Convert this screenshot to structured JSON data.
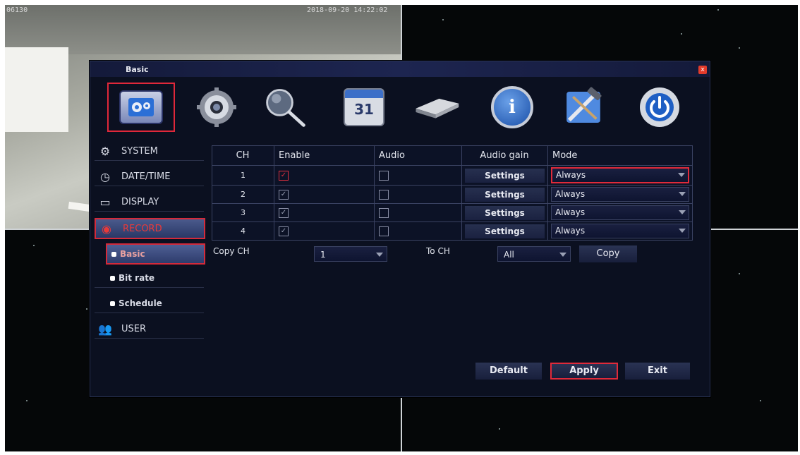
{
  "camera": {
    "channel_label": "06130",
    "timestamp": "2018-09-20 14:22:02"
  },
  "dialog": {
    "title": "Basic",
    "close_label": "x",
    "toolbar_icons": [
      "config-icon",
      "gear-icon",
      "search-icon",
      "calendar-icon",
      "hdd-icon",
      "info-icon",
      "tools-icon",
      "power-icon"
    ],
    "calendar_day": "31"
  },
  "menu": {
    "system": "SYSTEM",
    "datetime": "DATE/TIME",
    "display": "DISPLAY",
    "record": "RECORD",
    "basic": "Basic",
    "bitrate": "Bit rate",
    "schedule": "Schedule",
    "user": "USER"
  },
  "table": {
    "headers": [
      "CH",
      "Enable",
      "Audio",
      "Audio gain",
      "Mode"
    ],
    "rows": [
      {
        "ch": "1",
        "enable": true,
        "audio": false,
        "gain": "Settings",
        "mode": "Always"
      },
      {
        "ch": "2",
        "enable": true,
        "audio": false,
        "gain": "Settings",
        "mode": "Always"
      },
      {
        "ch": "3",
        "enable": true,
        "audio": false,
        "gain": "Settings",
        "mode": "Always"
      },
      {
        "ch": "4",
        "enable": true,
        "audio": false,
        "gain": "Settings",
        "mode": "Always"
      }
    ]
  },
  "copy": {
    "copy_ch_label": "Copy CH",
    "copy_ch_value": "1",
    "to_ch_label": "To CH",
    "to_ch_value": "All",
    "copy_button": "Copy"
  },
  "footer": {
    "default": "Default",
    "apply": "Apply",
    "exit": "Exit"
  },
  "colors": {
    "highlight": "#e02a3a",
    "dialog_bg": "#0b1020"
  }
}
